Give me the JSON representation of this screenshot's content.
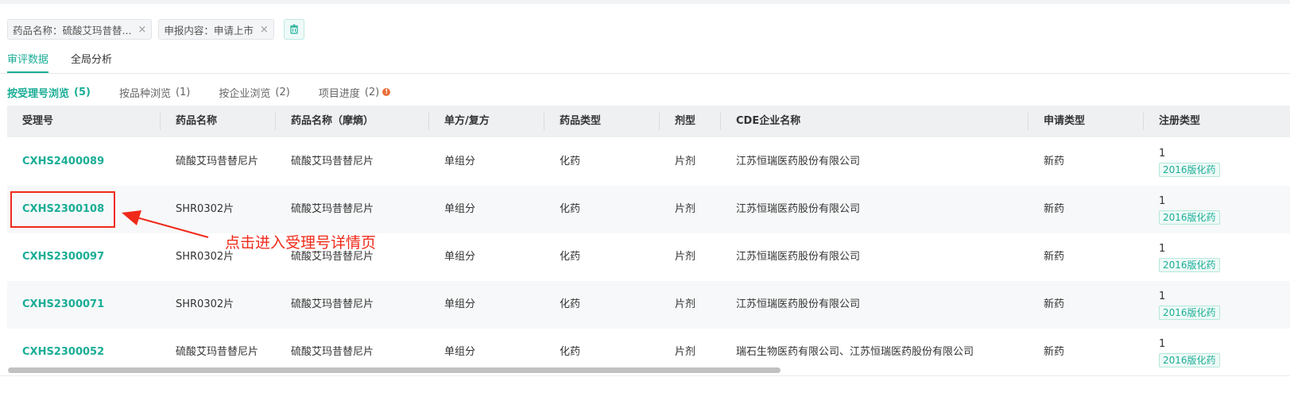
{
  "filters": {
    "chips": [
      {
        "text": "药品名称：硫酸艾玛昔替...",
        "close": "×"
      },
      {
        "text": "申报内容：申请上市",
        "close": "×"
      }
    ],
    "clear_icon": "trash-icon"
  },
  "tabs": [
    {
      "label": "审评数据",
      "active": true
    },
    {
      "label": "全局分析",
      "active": false
    }
  ],
  "subtabs": [
    {
      "label": "按受理号浏览",
      "count": "(5)",
      "active": true
    },
    {
      "label": "按品种浏览",
      "count": "(1)",
      "active": false
    },
    {
      "label": "按企业浏览",
      "count": "(2)",
      "active": false
    },
    {
      "label": "项目进度",
      "count": "(2)",
      "active": false,
      "info_icon": "!"
    }
  ],
  "table": {
    "columns": [
      "受理号",
      "药品名称",
      "药品名称（摩熵）",
      "单方/复方",
      "药品类型",
      "剂型",
      "CDE企业名称",
      "申请类型",
      "注册类型"
    ],
    "rows": [
      {
        "accept_no": "CXHS2400089",
        "drug": "硫酸艾玛昔替尼片",
        "drug_moshang": "硫酸艾玛昔替尼片",
        "compound": "单组分",
        "type": "化药",
        "form": "片剂",
        "company": "江苏恒瑞医药股份有限公司",
        "app_type": "新药",
        "reg_num": "1",
        "reg_tag": "2016版化药"
      },
      {
        "accept_no": "CXHS2300108",
        "drug": "SHR0302片",
        "drug_moshang": "硫酸艾玛昔替尼片",
        "compound": "单组分",
        "type": "化药",
        "form": "片剂",
        "company": "江苏恒瑞医药股份有限公司",
        "app_type": "新药",
        "reg_num": "1",
        "reg_tag": "2016版化药"
      },
      {
        "accept_no": "CXHS2300097",
        "drug": "SHR0302片",
        "drug_moshang": "硫酸艾玛昔替尼片",
        "compound": "单组分",
        "type": "化药",
        "form": "片剂",
        "company": "江苏恒瑞医药股份有限公司",
        "app_type": "新药",
        "reg_num": "1",
        "reg_tag": "2016版化药"
      },
      {
        "accept_no": "CXHS2300071",
        "drug": "SHR0302片",
        "drug_moshang": "硫酸艾玛昔替尼片",
        "compound": "单组分",
        "type": "化药",
        "form": "片剂",
        "company": "江苏恒瑞医药股份有限公司",
        "app_type": "新药",
        "reg_num": "1",
        "reg_tag": "2016版化药"
      },
      {
        "accept_no": "CXHS2300052",
        "drug": "硫酸艾玛昔替尼片",
        "drug_moshang": "硫酸艾玛昔替尼片",
        "compound": "单组分",
        "type": "化药",
        "form": "片剂",
        "company": "瑞石生物医药有限公司、江苏恒瑞医药股份有限公司",
        "app_type": "新药",
        "reg_num": "1",
        "reg_tag": "2016版化药"
      }
    ]
  },
  "annotation": {
    "text": "点击进入受理号详情页"
  },
  "colors": {
    "accent": "#1aad96",
    "annotation": "#f02a1a",
    "info": "#e8703a"
  }
}
